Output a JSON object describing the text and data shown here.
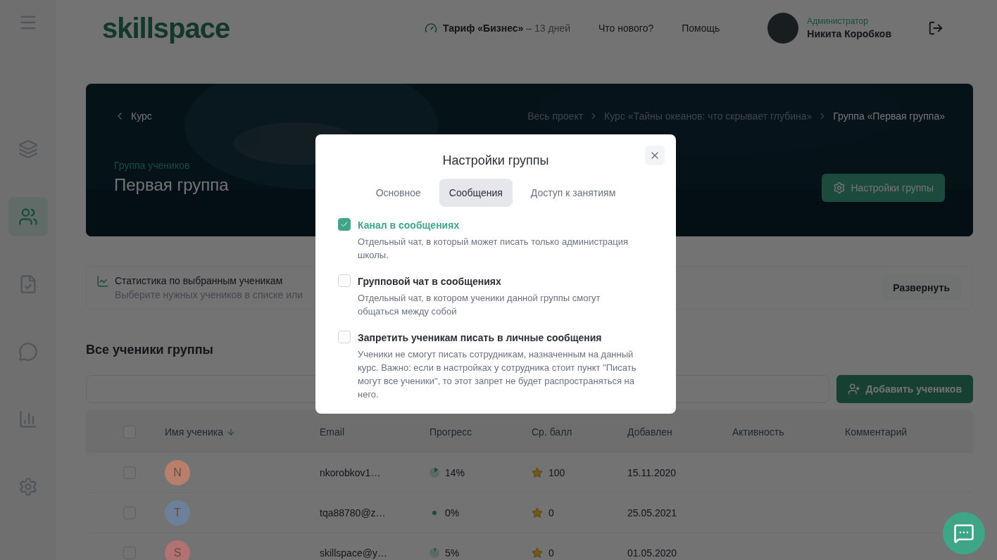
{
  "header": {
    "logo": "skillspace",
    "plan": {
      "label": "Тариф «Бизнес»",
      "days": "– 13 дней"
    },
    "links": [
      "Что нового?",
      "Помощь"
    ],
    "user": {
      "role": "Администратор",
      "name": "Никита Коробков"
    }
  },
  "sidebar": {
    "items": [
      {
        "kind": "layers",
        "selected": false
      },
      {
        "kind": "users",
        "selected": true
      },
      {
        "kind": "document",
        "selected": false
      },
      {
        "kind": "chat",
        "selected": false
      },
      {
        "kind": "chart",
        "selected": false
      },
      {
        "kind": "gear",
        "selected": false
      }
    ]
  },
  "hero": {
    "back": "Курс",
    "breadcrumbs": [
      "Весь проект",
      "Курс «Тайны океанов: что скрывает глубина»",
      "Группа «Первая группа»"
    ],
    "subtitle": "Группа учеников",
    "title": "Первая группа",
    "settings_button": "Настройки группы"
  },
  "stats": {
    "title": "Статистика по выбранным ученикам",
    "hint": "Выберите нужных учеников в списке или",
    "expand_button": "Развернуть"
  },
  "students": {
    "heading": "Все ученики группы",
    "add_button": "Добавить учеников",
    "select_all": {
      "checked": false
    },
    "columns": [
      "Имя ученика",
      "Email",
      "Прогресс",
      "Ср. балл",
      "Добавлен",
      "Активность",
      "Комментарий"
    ],
    "rows": [
      {
        "checked": false,
        "initial": "N",
        "color": "#b8806c",
        "email": "nkorobkov1…",
        "progress": "14%",
        "score": "100",
        "added": "15.11.2020"
      },
      {
        "checked": false,
        "initial": "T",
        "color": "#6d8099",
        "email": "tqa88780@z…",
        "progress": "0%",
        "score": "0",
        "added": "25.05.2021"
      },
      {
        "checked": false,
        "initial": "S",
        "color": "#b07272",
        "email": "skillspace@y…",
        "progress": "5%",
        "score": "0",
        "added": "01.05.2020"
      }
    ]
  },
  "modal": {
    "title": "Настройки группы",
    "tabs": [
      {
        "label": "Основное",
        "selected": false
      },
      {
        "label": "Сообщения",
        "selected": true
      },
      {
        "label": "Доступ к занятиям",
        "selected": false
      }
    ],
    "options": [
      {
        "label": "Канал в сообщениях",
        "description": "Отдельный чат, в который может писать только администрация школы.",
        "checked": true
      },
      {
        "label": "Групповой чат в сообщениях",
        "description": "Отдельный чат, в котором ученики данной группы смогут общаться между собой",
        "checked": false
      },
      {
        "label": "Запретить ученикам писать в личные сообщения",
        "description": "Ученики не смогут писать сотрудникам, назначенным на данный курс. Важно: если в настройках у сотрудника стоит пункт \"Писать могут все ученики\", то этот запрет не будет распространяться на него.",
        "checked": false
      }
    ]
  }
}
